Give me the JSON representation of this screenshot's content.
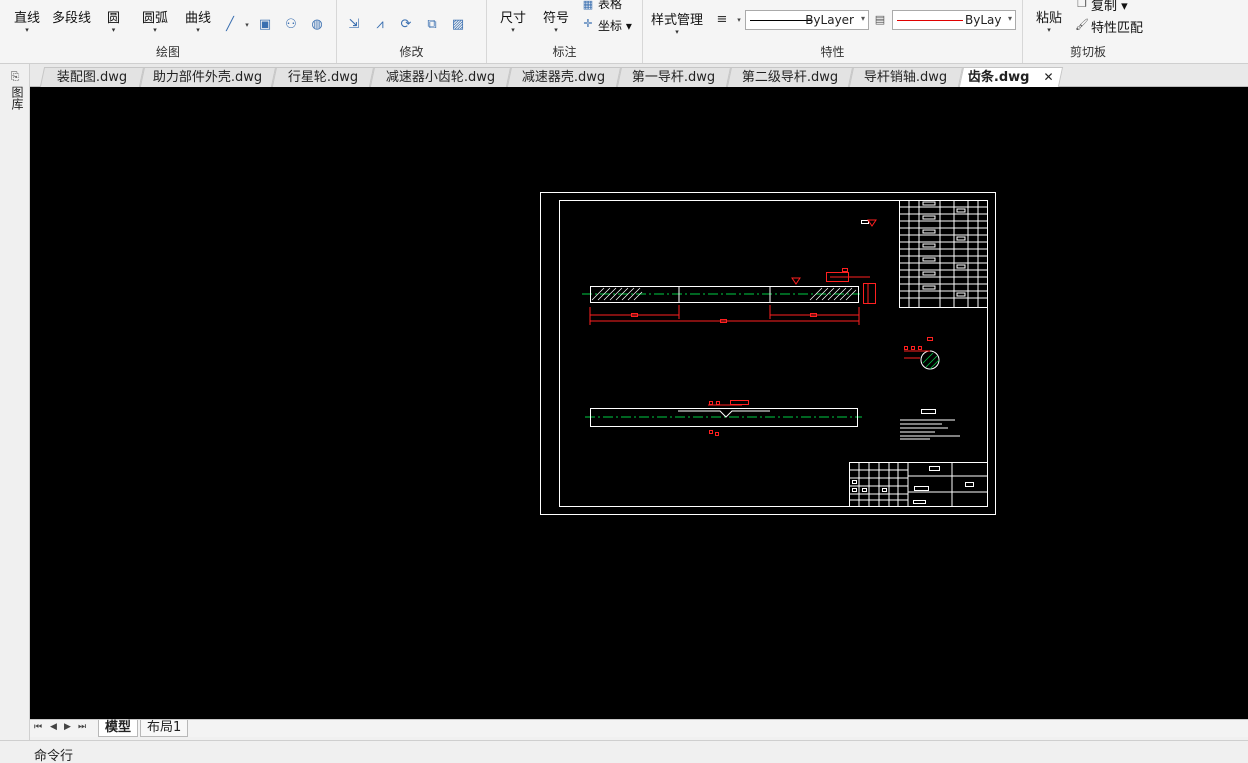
{
  "ribbon": {
    "draw": {
      "label": "绘图",
      "line": "直线",
      "polyline": "多段线",
      "circle": "圆",
      "arc": "圆弧",
      "curve": "曲线"
    },
    "modify": {
      "label": "修改"
    },
    "annotate": {
      "label": "标注",
      "dimension": "尺寸",
      "symbol": "符号",
      "table": "表格",
      "coordinate": "坐标"
    },
    "properties": {
      "label": "特性",
      "style_manager": "样式管理",
      "linetype": "ByLayer",
      "color": "ByLayer",
      "color_hex": "#e00000"
    },
    "clipboard": {
      "label": "剪切板",
      "paste": "粘贴",
      "copy": "复制",
      "match_properties": "特性匹配"
    }
  },
  "sidebar": {
    "label": "图库"
  },
  "doc_tabs": [
    "装配图.dwg",
    "助力部件外壳.dwg",
    "行星轮.dwg",
    "减速器小齿轮.dwg",
    "减速器壳.dwg",
    "第一导杆.dwg",
    "第二级导杆.dwg",
    "导杆销轴.dwg",
    "齿条.dwg"
  ],
  "active_doc": "齿条.dwg",
  "model_tabs": {
    "model": "模型",
    "layout1": "布局1"
  },
  "command_line": {
    "label": "命令行"
  },
  "colors": {
    "canvas": "#000000",
    "drawing_line": "#ffffff",
    "dimension": "#ff2020",
    "centerline": "#00cc44"
  }
}
